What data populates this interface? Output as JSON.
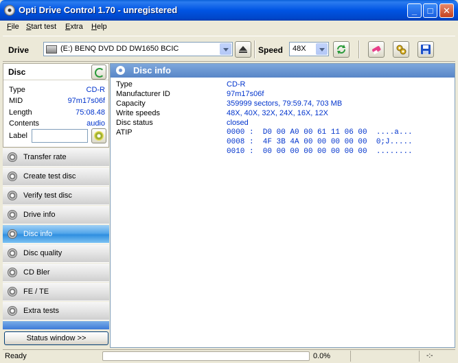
{
  "window": {
    "title": "Opti Drive Control 1.70 - unregistered",
    "minimize": "_",
    "maximize": "□",
    "close": "✕"
  },
  "menu": [
    {
      "key": "F",
      "rest": "ile"
    },
    {
      "key": "S",
      "rest": "tart test"
    },
    {
      "key": "E",
      "rest": "xtra"
    },
    {
      "key": "H",
      "rest": "elp"
    }
  ],
  "toolbar": {
    "drive_label": "Drive",
    "drive_value": "(E:)  BENQ DVD DD DW1650 BCIC",
    "speed_label": "Speed",
    "speed_value": "48X"
  },
  "disc": {
    "header": "Disc",
    "rows": [
      {
        "label": "Type",
        "value": "CD-R"
      },
      {
        "label": "MID",
        "value": "97m17s06f"
      },
      {
        "label": "Length",
        "value": "75:08.48"
      },
      {
        "label": "Contents",
        "value": "audio"
      }
    ],
    "label_label": "Label",
    "label_value": ""
  },
  "nav": [
    {
      "label": "Transfer rate"
    },
    {
      "label": "Create test disc"
    },
    {
      "label": "Verify test disc"
    },
    {
      "label": "Drive info"
    },
    {
      "label": "Disc info",
      "active": true
    },
    {
      "label": "Disc quality"
    },
    {
      "label": "CD Bler"
    },
    {
      "label": "FE / TE"
    },
    {
      "label": "Extra tests"
    }
  ],
  "status_window_button": "Status window >>",
  "main": {
    "title": "Disc info",
    "rows": [
      {
        "label": "Type",
        "value": "CD-R"
      },
      {
        "label": "Manufacturer ID",
        "value": "97m17s06f"
      },
      {
        "label": "Capacity",
        "value": "359999 sectors, 79:59.74, 703 MB"
      },
      {
        "label": "Write speeds",
        "value": "48X, 40X, 32X, 24X, 16X, 12X"
      },
      {
        "label": "Disc status",
        "value": "closed"
      }
    ],
    "atip_label": "ATIP",
    "atip_lines": [
      "0000 :  D0 00 A0 00 61 11 06 00  ....a...",
      "0008 :  4F 3B 4A 00 00 00 00 00  0;J.....",
      "0010 :  00 00 00 00 00 00 00 00  ........"
    ]
  },
  "statusbar": {
    "text": "Ready",
    "progress_fraction": 0.0,
    "percent": "0.0%",
    "right": "-:-"
  }
}
